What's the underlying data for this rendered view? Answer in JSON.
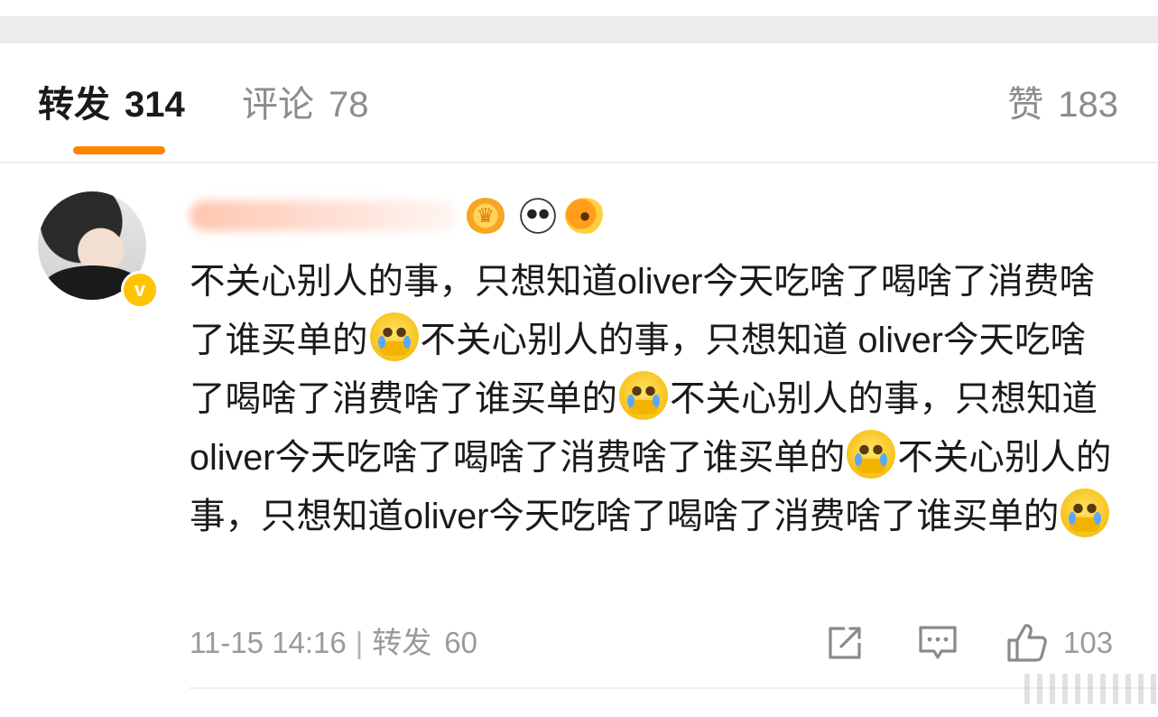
{
  "tabs": [
    {
      "label": "转发",
      "count": "314"
    },
    {
      "label": "评论",
      "count": "78"
    },
    {
      "label": "赞",
      "count": "183"
    }
  ],
  "colors": {
    "accent": "#ff8200",
    "verified_badge": "#ffc300",
    "muted_text": "#9a9a9a"
  },
  "comment": {
    "verified_mark": "v",
    "segments": [
      "不关心别人的事，只想知道oliver今天吃啥了喝啥了消费啥了谁买单的",
      "不关心别人的事，只想知道 oliver今天吃啥了喝啥了消费啥了谁买单的",
      "不关心别人的事，只想知道oliver今天吃啥了喝啥了消费啥了谁买单的",
      "不关心别人的事，只想知道oliver今天吃啥了喝啥了消费啥了谁买单的"
    ],
    "emoji": "crying-face-covering-mouth",
    "timestamp": "11-15 14:16",
    "separator": "|",
    "repost_label": "转发",
    "repost_count": "60",
    "like_count": "103"
  },
  "icons": {
    "badges": [
      "crown-medal-icon",
      "panda-icon",
      "goldfish-icon"
    ],
    "actions": [
      "share-icon",
      "comment-icon",
      "thumbs-up-icon"
    ]
  }
}
